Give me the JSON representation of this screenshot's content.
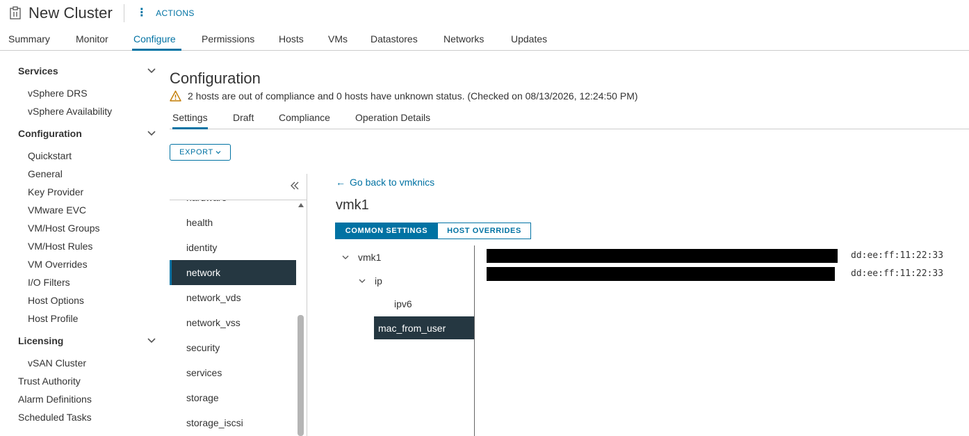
{
  "header": {
    "title": "New Cluster",
    "actions_label": "ACTIONS",
    "icon": "cluster-icon"
  },
  "main_tabs": [
    {
      "label": "Summary",
      "active": false
    },
    {
      "label": "Monitor",
      "active": false
    },
    {
      "label": "Configure",
      "active": true
    },
    {
      "label": "Permissions",
      "active": false
    },
    {
      "label": "Hosts",
      "active": false
    },
    {
      "label": "VMs",
      "active": false
    },
    {
      "label": "Datastores",
      "active": false
    },
    {
      "label": "Networks",
      "active": false
    },
    {
      "label": "Updates",
      "active": false
    }
  ],
  "sidebar": {
    "services": {
      "label": "Services",
      "items": [
        "vSphere DRS",
        "vSphere Availability"
      ]
    },
    "configuration": {
      "label": "Configuration",
      "items": [
        "Quickstart",
        "General",
        "Key Provider",
        "VMware EVC",
        "VM/Host Groups",
        "VM/Host Rules",
        "VM Overrides",
        "I/O Filters",
        "Host Options",
        "Host Profile"
      ]
    },
    "licensing": {
      "label": "Licensing",
      "items": [
        "vSAN Cluster"
      ]
    },
    "other_items": [
      "Trust Authority",
      "Alarm Definitions",
      "Scheduled Tasks"
    ]
  },
  "config": {
    "title": "Configuration",
    "warning": "2 hosts are out of compliance and 0 hosts have unknown status. (Checked on 08/13/2026, 12:24:50 PM)",
    "sub_tabs": [
      {
        "label": "Settings",
        "active": true
      },
      {
        "label": "Draft",
        "active": false
      },
      {
        "label": "Compliance",
        "active": false
      },
      {
        "label": "Operation Details",
        "active": false
      }
    ],
    "export_label": "EXPORT"
  },
  "tree": {
    "partial_item": "hardware",
    "items": [
      "health",
      "identity",
      "network",
      "network_vds",
      "network_vss",
      "security",
      "services",
      "storage",
      "storage_iscsi"
    ],
    "selected": "network"
  },
  "detail": {
    "back_link": "Go back to vmknics",
    "title": "vmk1",
    "segments": {
      "common": "COMMON SETTINGS",
      "overrides": "HOST OVERRIDES"
    },
    "nodes": {
      "vmk1": "vmk1",
      "ip": "ip",
      "ipv6": "ipv6",
      "mac_from_user": "mac_from_user"
    },
    "mac_values": [
      "dd:ee:ff:11:22:33",
      "dd:ee:ff:11:22:33"
    ]
  },
  "colors": {
    "accent": "#0072a3",
    "selected_bg": "#253741",
    "warning": "#c27b00"
  }
}
